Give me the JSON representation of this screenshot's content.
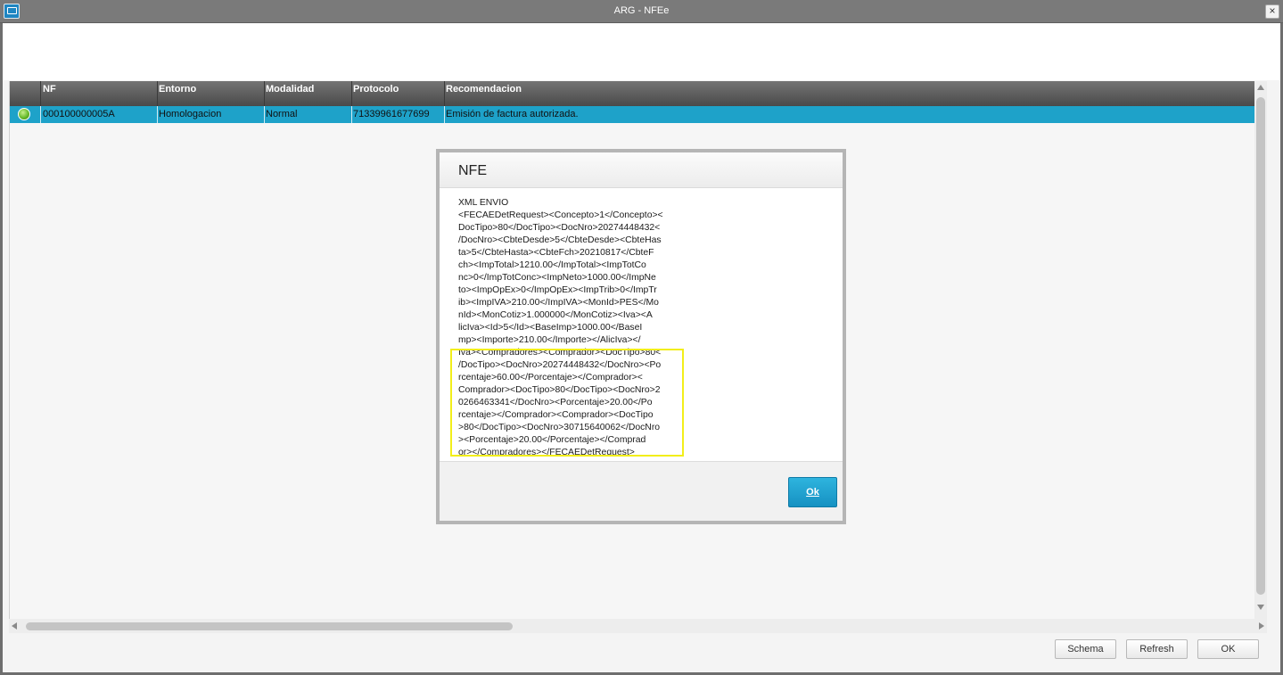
{
  "window": {
    "title": "ARG - NFEe",
    "close_glyph": "×",
    "icon": "app-window-icon"
  },
  "grid": {
    "columns": [
      "NF",
      "Entorno",
      "Modalidad",
      "Protocolo",
      "Recomendacion"
    ],
    "rows": [
      {
        "status": "green-circle-icon",
        "nf": "000100000005A",
        "entorno": "Homologacion",
        "modalidad": "Normal",
        "protocolo": "71339961677699",
        "recomendacion": "Emisión de factura autorizada."
      }
    ]
  },
  "buttons": {
    "schema": "Schema",
    "refresh": "Refresh",
    "ok": "OK"
  },
  "modal": {
    "title": "NFE",
    "xml_lines": [
      "XML ENVIO",
      "<FECAEDetRequest><Concepto>1</Concepto><",
      "DocTipo>80</DocTipo><DocNro>20274448432<",
      "/DocNro><CbteDesde>5</CbteDesde><CbteHas",
      "ta>5</CbteHasta><CbteFch>20210817</CbteF",
      "ch><ImpTotal>1210.00</ImpTotal><ImpTotCo",
      "nc>0</ImpTotConc><ImpNeto>1000.00</ImpNe",
      "to><ImpOpEx>0</ImpOpEx><ImpTrib>0</ImpTr",
      "ib><ImpIVA>210.00</ImpIVA><MonId>PES</Mo",
      "nId><MonCotiz>1.000000</MonCotiz><Iva><A",
      "licIva><Id>5</Id><BaseImp>1000.00</BaseI",
      "mp><Importe>210.00</Importe></AlicIva></",
      "Iva><Compradores><Comprador><DocTipo>80<",
      "/DocTipo><DocNro>20274448432</DocNro><Po",
      "rcentaje>60.00</Porcentaje></Comprador><",
      "Comprador><DocTipo>80</DocTipo><DocNro>2",
      "0266463341</DocNro><Porcentaje>20.00</Po",
      "rcentaje></Comprador><Comprador><DocTipo",
      ">80</DocTipo><DocNro>30715640062</DocNro",
      "><Porcentaje>20.00</Porcentaje></Comprad",
      "or></Compradores></FECAEDetRequest>"
    ],
    "ok_label": "Ok",
    "highlight_color": "#f2ee1a"
  },
  "colors": {
    "selected_row": "#1ea2c9",
    "header": "#5a5a5a",
    "ok_button": "#1ea2c9"
  }
}
